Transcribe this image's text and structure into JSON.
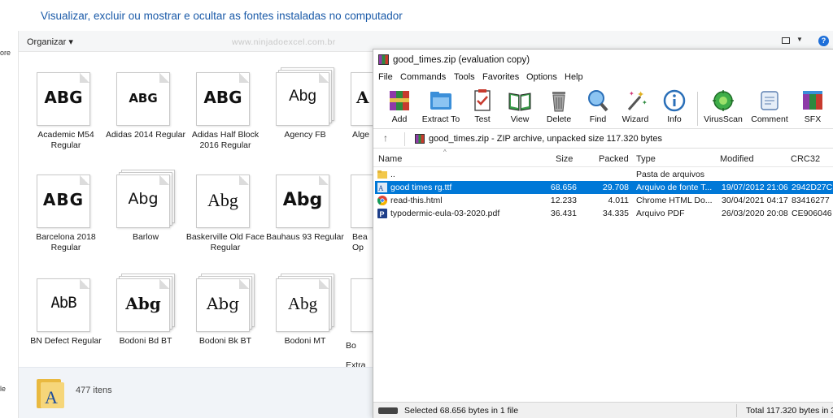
{
  "heading": "Visualizar, excluir ou mostrar e ocultar as fontes instaladas no computador",
  "side_fragments": [
    "ore",
    "le"
  ],
  "explorer": {
    "organize_label": "Organizar",
    "watermark": "www.ninjadoexcel.com.br",
    "status_count": "477 itens",
    "folder_letter": "A",
    "fonts": [
      {
        "sample": "ABG",
        "label": "Academic M54 Regular"
      },
      {
        "sample": "ABG",
        "label": "Adidas 2014 Regular"
      },
      {
        "sample": "ABG",
        "label": "Adidas Half Block 2016 Regular"
      },
      {
        "sample": "Abg",
        "label": "Agency FB"
      },
      {
        "sample": "A",
        "label": "Alge"
      },
      {
        "sample": "ABG",
        "label": "Barcelona 2018 Regular"
      },
      {
        "sample": "Abg",
        "label": "Barlow"
      },
      {
        "sample": "Abg",
        "label": "Baskerville Old Face Regular"
      },
      {
        "sample": "Abg",
        "label": "Bauhaus 93 Regular"
      },
      {
        "sample": "",
        "label": "Bea Op"
      },
      {
        "sample": "AbB",
        "label": "BN Defect Regular"
      },
      {
        "sample": "Abg",
        "label": "Bodoni Bd BT"
      },
      {
        "sample": "Abg",
        "label": "Bodoni Bk BT"
      },
      {
        "sample": "Abg",
        "label": "Bodoni MT"
      },
      {
        "sample": "",
        "label": "Bo Extra"
      }
    ]
  },
  "zip": {
    "title": "good_times.zip (evaluation copy)",
    "menu": [
      "File",
      "Commands",
      "Tools",
      "Favorites",
      "Options",
      "Help"
    ],
    "toolbar": [
      "Add",
      "Extract To",
      "Test",
      "View",
      "Delete",
      "Find",
      "Wizard",
      "Info",
      "VirusScan",
      "Comment",
      "SFX"
    ],
    "address": "good_times.zip - ZIP archive, unpacked size 117.320 bytes",
    "columns": [
      "Name",
      "Size",
      "Packed",
      "Type",
      "Modified",
      "CRC32"
    ],
    "files": [
      {
        "name": "..",
        "size": "",
        "packed": "",
        "type": "Pasta de arquivos",
        "modified": "",
        "crc": "",
        "icon": "folder-icon",
        "selected": false
      },
      {
        "name": "good times rg.ttf",
        "size": "68.656",
        "packed": "29.708",
        "type": "Arquivo de fonte T...",
        "modified": "19/07/2012 21:06",
        "crc": "2942D27C",
        "icon": "font-file-icon",
        "selected": true
      },
      {
        "name": "read-this.html",
        "size": "12.233",
        "packed": "4.011",
        "type": "Chrome HTML Do...",
        "modified": "30/04/2021 04:17",
        "crc": "83416277",
        "icon": "chrome-icon",
        "selected": false
      },
      {
        "name": "typodermic-eula-03-2020.pdf",
        "size": "36.431",
        "packed": "34.335",
        "type": "Arquivo PDF",
        "modified": "26/03/2020 20:08",
        "crc": "CE906046",
        "icon": "pdf-icon",
        "selected": false
      }
    ],
    "status_left": "Selected 68.656 bytes in 1 file",
    "status_right": "Total 117.320 bytes in 3"
  }
}
